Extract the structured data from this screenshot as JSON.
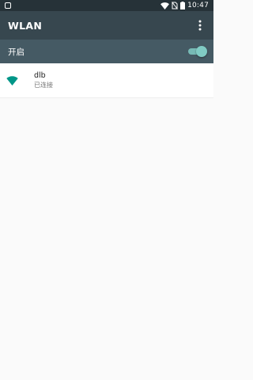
{
  "status_bar": {
    "time": "10:47",
    "icons": [
      "notification-icon",
      "wifi-signal-icon",
      "no-sim-icon",
      "battery-icon"
    ]
  },
  "app_bar": {
    "title": "WLAN",
    "overflow_icon": "more-vert-icon"
  },
  "switch_bar": {
    "label": "开启",
    "enabled": true
  },
  "networks": [
    {
      "name": "dlb",
      "status": "已连接",
      "icon": "wifi-signal-icon"
    }
  ],
  "colors": {
    "status_bar": "#263238",
    "app_bar": "#37474f",
    "switch_bar": "#455a64",
    "accent": "#009688",
    "toggle_on": "#80cbc4"
  }
}
